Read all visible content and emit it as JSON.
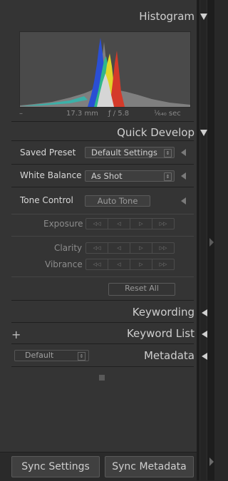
{
  "histogram": {
    "title": "Histogram",
    "info_dash": "–",
    "focal_length": "17.3 mm",
    "aperture": "ƒ / 5.8",
    "shutter": "¹⁄₆₄₀ sec"
  },
  "quick_develop": {
    "title": "Quick Develop",
    "saved_preset_label": "Saved Preset",
    "saved_preset_value": "Default Settings",
    "white_balance_label": "White Balance",
    "white_balance_value": "As Shot",
    "tone_control_label": "Tone Control",
    "auto_tone_label": "Auto Tone",
    "exposure_label": "Exposure",
    "clarity_label": "Clarity",
    "vibrance_label": "Vibrance",
    "reset_all_label": "Reset All",
    "stepper_glyphs": [
      "◁◁",
      "◁",
      "▷",
      "▷▷"
    ]
  },
  "keywording": {
    "title": "Keywording"
  },
  "keyword_list": {
    "title": "Keyword List",
    "add_glyph": "+"
  },
  "metadata": {
    "title": "Metadata",
    "preset_value": "Default",
    "spinner_glyph": "⇕"
  },
  "footer": {
    "sync_settings_label": "Sync Settings",
    "sync_metadata_label": "Sync Metadata"
  },
  "colors": {
    "panel": "#343434",
    "text": "#cfcfcf"
  }
}
